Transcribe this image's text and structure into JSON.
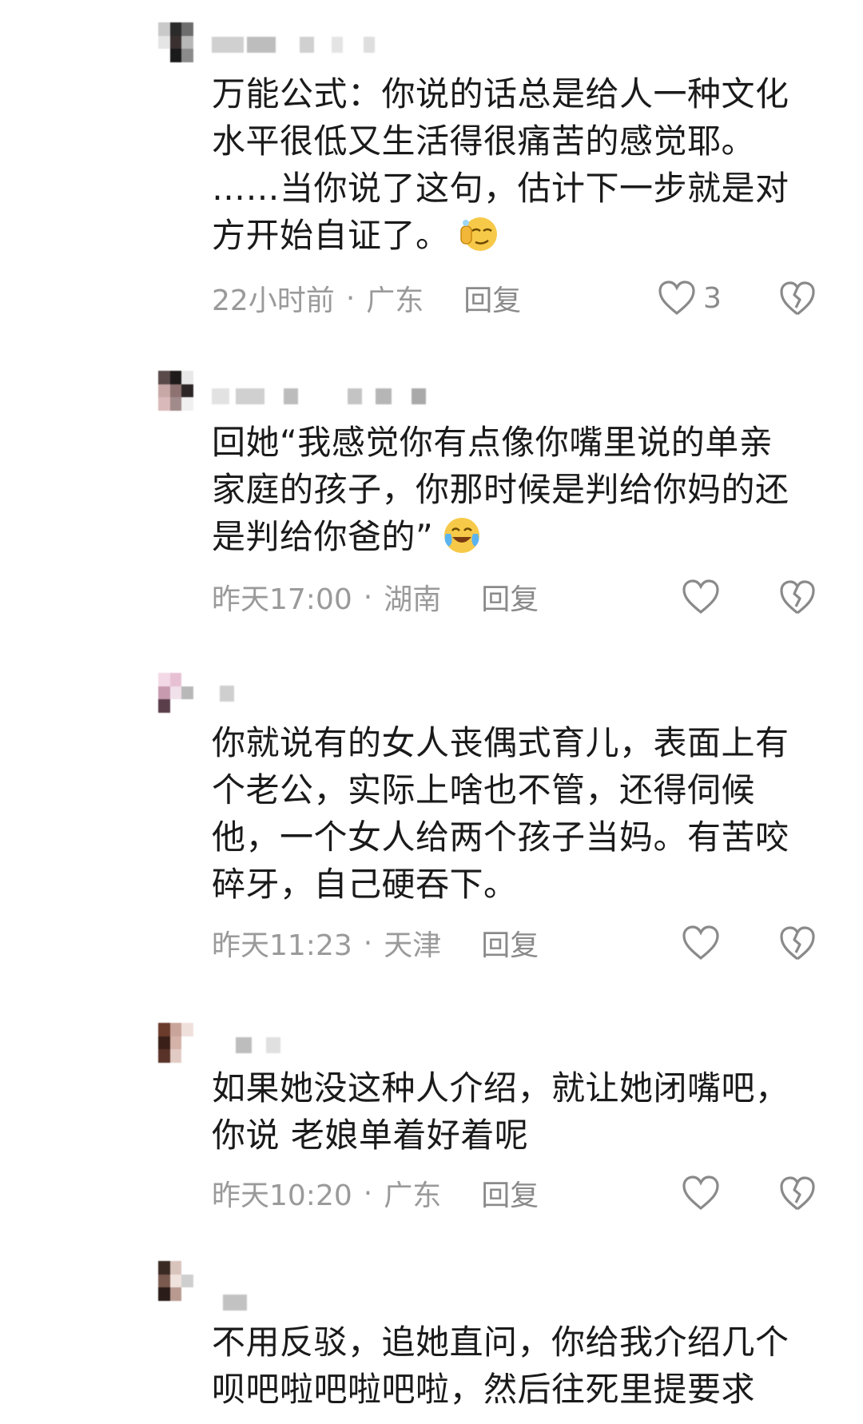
{
  "comments": [
    {
      "text": "万能公式：你说的话总是给人一种文化\n水平很低又生活得很痛苦的感觉耶。\n……当你说了这句，估计下一步就是对\n方开始自证了。",
      "emoji": "smirk-salute-emoji",
      "time": "22小时前",
      "location": "广东",
      "reply_label": "回复",
      "likes": "3"
    },
    {
      "text": "回她“我感觉你有点像你嘴里说的单亲\n家庭的孩子，你那时候是判给你妈的还\n是判给你爸的”",
      "emoji": "laugh-cry-emoji",
      "time": "昨天17:00",
      "location": "湖南",
      "reply_label": "回复",
      "likes": ""
    },
    {
      "text": "你就说有的女人丧偶式育儿，表面上有\n个老公，实际上啥也不管，还得伺候\n他，一个女人给两个孩子当妈。有苦咬\n碎牙，自己硬吞下。",
      "time": "昨天11:23",
      "location": "天津",
      "reply_label": "回复",
      "likes": ""
    },
    {
      "text": "如果她没这种人介绍，就让她闭嘴吧，\n你说 老娘单着好着呢",
      "time": "昨天10:20",
      "location": "广东",
      "reply_label": "回复",
      "likes": ""
    },
    {
      "text": "不用反驳，追她直问，你给我介绍几个\n呗吧啦吧啦吧啦，然后往死里提要求",
      "time": "",
      "location": "",
      "reply_label": "",
      "likes": ""
    }
  ],
  "colors": {
    "text": "#1a1a1a",
    "meta": "#9a9a9a",
    "icon": "#8a8a8a"
  }
}
